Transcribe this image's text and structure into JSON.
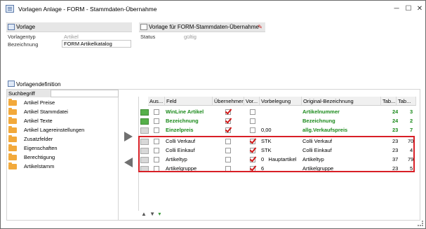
{
  "window": {
    "title": "Vorlagen Anlage - FORM - Stammdaten-Übernahme",
    "min_icon": "minimize-icon",
    "max_icon": "maximize-icon",
    "close_icon": "close-icon",
    "min_glyph": "─",
    "max_glyph": "☐",
    "close_glyph": "✕"
  },
  "vorlage": {
    "header": "Vorlage",
    "rows": [
      {
        "label": "Vorlagentyp",
        "value": "Artikel"
      },
      {
        "label": "Bezeichnung",
        "value": "FORM Artikelkatalog"
      }
    ]
  },
  "vorlage_fuer": {
    "header": "Vorlage für FORM-Stammdaten-Übernahme",
    "status_label": "Status",
    "status_value": "gültig"
  },
  "vorlagendefinition": {
    "header": "Vorlagendefinition",
    "search_label": "Suchbegriff",
    "items": [
      "Artikel Preise",
      "Artikel Stammdatei",
      "Artikel Texte",
      "Artikel Lagereinstellungen",
      "Zusatzfelder",
      "Eigenschaften",
      "Berechtigung",
      "Artikelstamm"
    ]
  },
  "table": {
    "headers": [
      "Aus...",
      "Feld",
      "Übernehmen",
      "Vor...",
      "Vorbelegung",
      "Original-Bezeichnung",
      "Tab...",
      "Tab..."
    ],
    "rows": [
      {
        "feld": "WinLine Artikel",
        "uebernehmen": true,
        "vor": false,
        "vorbelegung": "",
        "original": "Artikelnummer",
        "tab1": "24",
        "tab2": "3",
        "green": true
      },
      {
        "feld": "Bezeichnung",
        "uebernehmen": true,
        "vor": false,
        "vorbelegung": "",
        "original": "Bezeichnung",
        "tab1": "24",
        "tab2": "2",
        "green": true
      },
      {
        "feld": "Einzelpreis",
        "uebernehmen": true,
        "vor": false,
        "vorbelegung": "0,00",
        "original": "allg.Verkaufspreis",
        "tab1": "23",
        "tab2": "7",
        "green": true
      },
      {
        "feld": "Colli Verkauf",
        "uebernehmen": false,
        "vor": true,
        "vorbelegung": "STK",
        "original": "Colli Verkauf",
        "tab1": "23",
        "tab2": "70",
        "green": false
      },
      {
        "feld": "Colli Einkauf",
        "uebernehmen": false,
        "vor": true,
        "vorbelegung": "STK",
        "original": "Colli Einkauf",
        "tab1": "23",
        "tab2": "4",
        "green": false
      },
      {
        "feld": "Artikeltyp",
        "uebernehmen": false,
        "vor": true,
        "vorbelegung": "0   Hauptartikel",
        "original": "Artikeltyp",
        "tab1": "37",
        "tab2": "79",
        "green": false
      },
      {
        "feld": "Artikelgruppe",
        "uebernehmen": false,
        "vor": true,
        "vorbelegung": "6",
        "original": "Artikelgruppe",
        "tab1": "23",
        "tab2": "5",
        "green": false
      }
    ]
  },
  "colors": {
    "accent_green": "#1b8a1b",
    "highlight_red": "#d81f26",
    "check_red": "#d01818"
  }
}
